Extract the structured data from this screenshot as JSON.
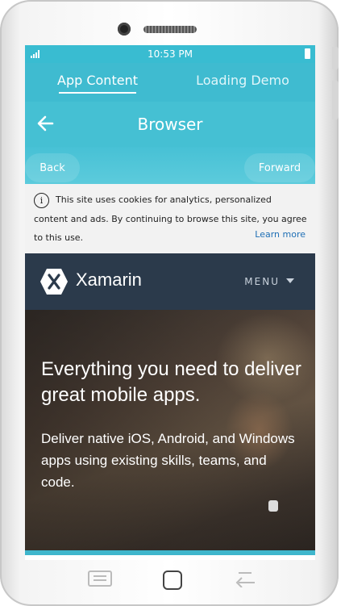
{
  "status_bar": {
    "time": "10:53 PM"
  },
  "tabs": [
    {
      "label": "App Content",
      "active": true
    },
    {
      "label": "Loading Demo",
      "active": false
    }
  ],
  "title_bar": {
    "title": "Browser"
  },
  "nav": {
    "back_label": "Back",
    "forward_label": "Forward"
  },
  "cookie_banner": {
    "text": "This site uses cookies for analytics, personalized content and ads. By continuing to browse this site, you agree to this use.",
    "learn_more": "Learn more"
  },
  "site": {
    "logo_text": "Xamarin",
    "menu_label": "MENU",
    "hero_title": "Everything you need to deliver great mobile apps.",
    "hero_subtitle": "Deliver native iOS, Android, and Windows apps using existing skills, teams, and code."
  },
  "colors": {
    "accent": "#3fbbd0",
    "site_header": "#2b3a4b",
    "link": "#1f6fb5"
  }
}
